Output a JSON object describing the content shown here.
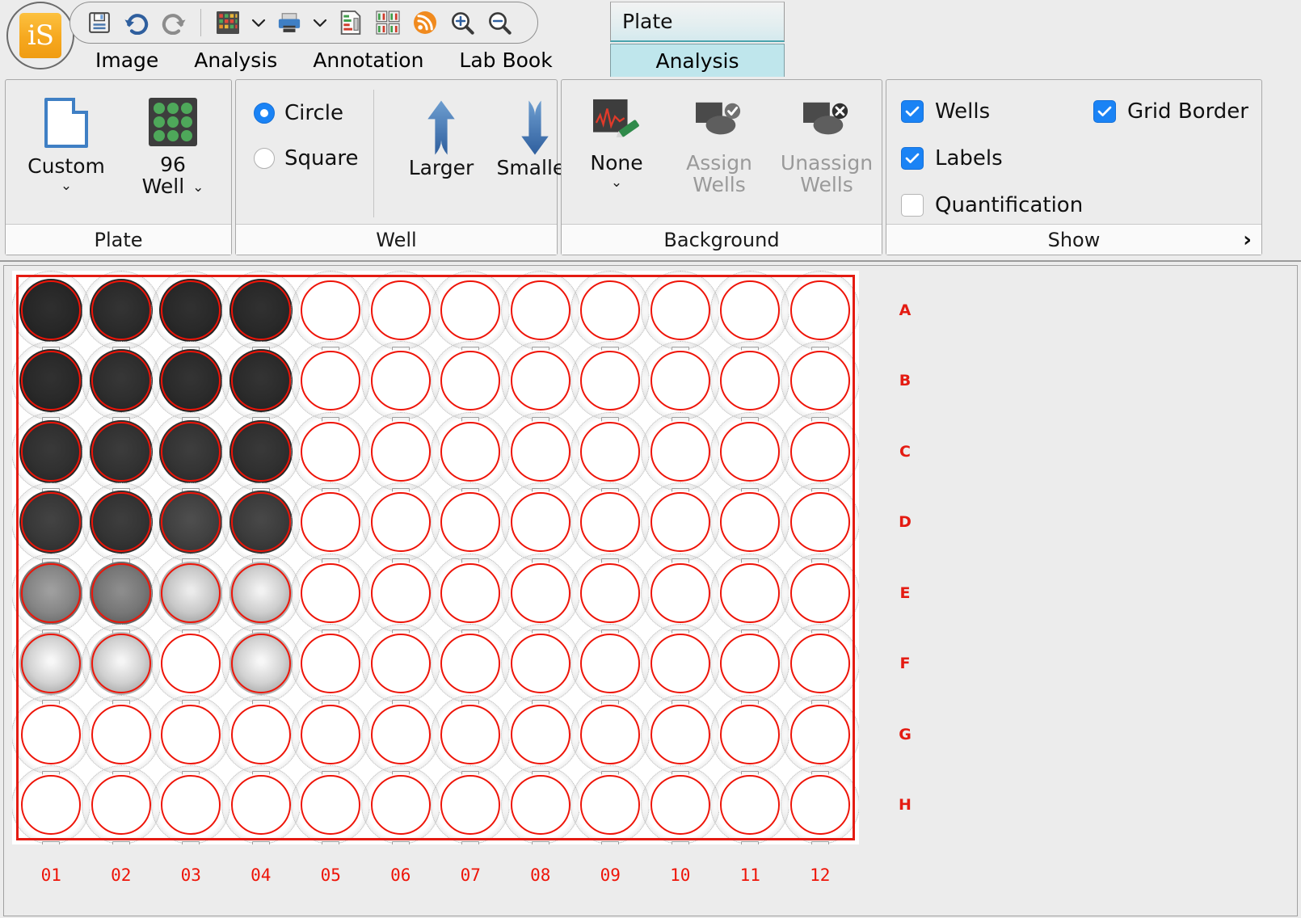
{
  "app": {
    "logo_text": "iS"
  },
  "toolbar": {
    "items": [
      {
        "name": "save-icon",
        "title": "Save"
      },
      {
        "name": "undo-icon",
        "title": "Undo"
      },
      {
        "name": "redo-icon",
        "title": "Redo"
      },
      {
        "name": "plate-color-icon",
        "title": "Plate View"
      },
      {
        "name": "plate-color-dropdown-icon",
        "title": "Plate View Options"
      },
      {
        "name": "print-icon",
        "title": "Print"
      },
      {
        "name": "print-dropdown-icon",
        "title": "Print Options"
      },
      {
        "name": "report-icon",
        "title": "Report"
      },
      {
        "name": "multi-panel-icon",
        "title": "Multi Panel"
      },
      {
        "name": "feed-icon",
        "title": "Feed"
      },
      {
        "name": "zoom-in-icon",
        "title": "Zoom In"
      },
      {
        "name": "zoom-out-icon",
        "title": "Zoom Out"
      }
    ]
  },
  "menu": {
    "tabs": [
      {
        "label": "Image"
      },
      {
        "label": "Analysis"
      },
      {
        "label": "Annotation"
      },
      {
        "label": "Lab Book"
      }
    ],
    "context_group": {
      "title": "Plate",
      "active_tab": "Analysis"
    }
  },
  "ribbon": {
    "panels": [
      {
        "id": "plate",
        "title": "Plate",
        "buttons": [
          {
            "label_line1": "Custom",
            "label_line2": "",
            "icon": "document-icon",
            "has_caret": true,
            "disabled": false
          },
          {
            "label_line1": "96",
            "label_line2": "Well",
            "icon": "grid-96-icon",
            "has_caret": true,
            "disabled": false
          }
        ]
      },
      {
        "id": "well",
        "title": "Well",
        "radios": [
          {
            "label": "Circle",
            "selected": true
          },
          {
            "label": "Square",
            "selected": false
          }
        ],
        "buttons": [
          {
            "label_line1": "Larger",
            "icon": "arrow-up-icon",
            "disabled": false
          },
          {
            "label_line1": "Smaller",
            "icon": "arrow-down-icon",
            "disabled": false
          }
        ]
      },
      {
        "id": "background",
        "title": "Background",
        "buttons": [
          {
            "label_line1": "None",
            "label_line2": "",
            "icon": "background-none-icon",
            "has_caret": true,
            "disabled": false
          },
          {
            "label_line1": "Assign",
            "label_line2": "Wells",
            "icon": "assign-wells-icon",
            "has_caret": false,
            "disabled": true
          },
          {
            "label_line1": "Unassign",
            "label_line2": "Wells",
            "icon": "unassign-wells-icon",
            "has_caret": false,
            "disabled": true
          }
        ]
      },
      {
        "id": "show",
        "title": "Show",
        "expand_glyph": "›",
        "checkboxes": [
          {
            "label": "Wells",
            "checked": true
          },
          {
            "label": "Labels",
            "checked": true
          },
          {
            "label": "Quantification",
            "checked": false
          },
          {
            "label": "Grid Border",
            "checked": true
          }
        ]
      }
    ]
  },
  "plate": {
    "format": "96 Well",
    "rows": [
      "A",
      "B",
      "C",
      "D",
      "E",
      "F",
      "G",
      "H"
    ],
    "columns": [
      "01",
      "02",
      "03",
      "04",
      "05",
      "06",
      "07",
      "08",
      "09",
      "10",
      "11",
      "12"
    ],
    "grid_border_color": "#e41b12",
    "well_outline_color": "#ee1408",
    "label_color": "#e41b12",
    "well_shape": "Circle",
    "intensities": [
      [
        18,
        20,
        19,
        19,
        100,
        100,
        100,
        100,
        100,
        100,
        100,
        100
      ],
      [
        19,
        21,
        20,
        20,
        100,
        100,
        100,
        100,
        100,
        100,
        100,
        100
      ],
      [
        22,
        23,
        24,
        22,
        100,
        100,
        100,
        100,
        100,
        100,
        100,
        100
      ],
      [
        26,
        24,
        30,
        28,
        100,
        100,
        100,
        100,
        100,
        100,
        100,
        100
      ],
      [
        62,
        55,
        92,
        95,
        100,
        100,
        100,
        100,
        100,
        100,
        100,
        100
      ],
      [
        97,
        96,
        99,
        97,
        100,
        100,
        100,
        100,
        100,
        100,
        100,
        100
      ],
      [
        100,
        100,
        100,
        100,
        100,
        100,
        100,
        100,
        100,
        100,
        100,
        100
      ],
      [
        100,
        100,
        100,
        100,
        100,
        100,
        100,
        100,
        100,
        100,
        100,
        100
      ]
    ]
  }
}
